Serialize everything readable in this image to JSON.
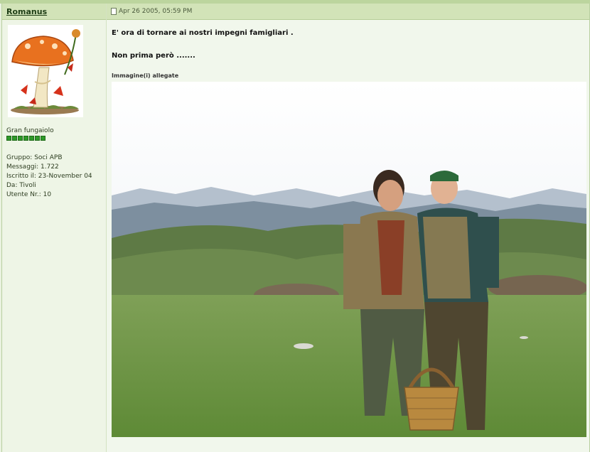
{
  "post": {
    "author": "Romanus",
    "date": "Apr 26 2005, 05:59 PM",
    "rank": "Gran fungaiolo",
    "rank_pips": 7,
    "info": {
      "group": "Gruppo: Soci APB",
      "posts": "Messaggi: 1.722",
      "registered": "Iscritto il: 23-November 04",
      "from": "Da: Tivoli",
      "user_no": "Utente Nr.: 10"
    },
    "message_line1": "E' ora di tornare ai nostri impegni famigliari .",
    "message_line2": "Non prima però .......",
    "attachments_label": "Immagine(i) allegate"
  },
  "colors": {
    "header_bg": "#d2e3b8",
    "panel_bg": "#eef5e6",
    "pip_green": "#2f9a2a"
  },
  "icons": [
    "document-icon",
    "mushroom-avatar"
  ]
}
